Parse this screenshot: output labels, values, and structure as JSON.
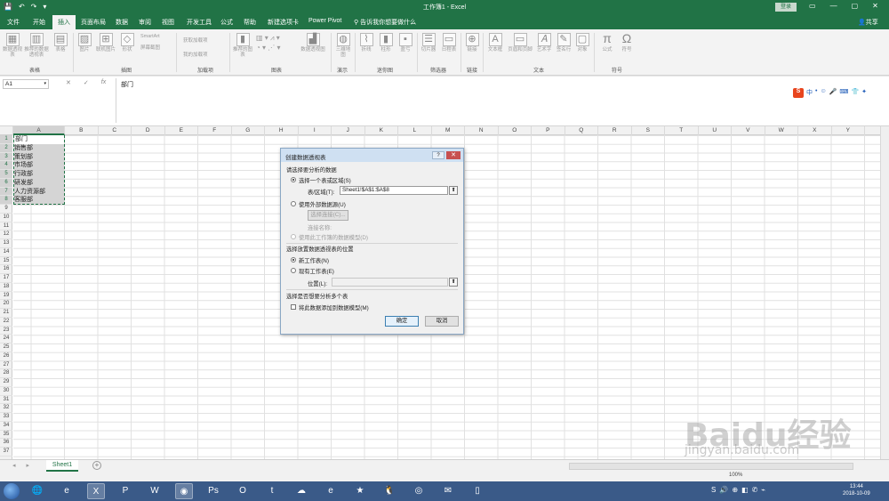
{
  "titlebar": {
    "title": "工作簿1 - Excel",
    "login": "登录",
    "qat": [
      "💾",
      "↶",
      "↷",
      "▾"
    ],
    "win": [
      "▭",
      "—",
      "▢",
      "✕"
    ]
  },
  "tabs": {
    "items": [
      "文件",
      "开始",
      "插入",
      "页面布局",
      "数据",
      "审阅",
      "视图",
      "开发工具",
      "公式",
      "帮助",
      "新建选项卡",
      "Power Pivot"
    ],
    "active": "插入",
    "tell_me": "告诉我你想要做什么",
    "share": "共享"
  },
  "ribbon": {
    "groups": [
      "表格",
      "插图",
      "加载项",
      "图表",
      "演示",
      "迷你图",
      "筛选器",
      "链接",
      "文本",
      "符号"
    ],
    "buttons": {
      "pivot": "数据透视表",
      "rec_pivot": "推荐的数据透视表",
      "table": "表格",
      "pictures": "图片",
      "online_pictures": "联机图片",
      "shapes": "形状",
      "smartart": "SmartArt",
      "screenshot": "屏幕截图",
      "get_addins": "获取加载项",
      "my_addins": "我的加载项",
      "rec_charts": "推荐的图表",
      "pivot_chart": "数据透视图",
      "map3d": "三维地图",
      "line": "折线",
      "column": "柱形",
      "winloss": "盈亏",
      "slicer": "切片器",
      "timeline": "日程表",
      "link": "链接",
      "textbox": "文本框",
      "header_footer": "页眉和页脚",
      "wordart": "艺术字",
      "signature": "签名行",
      "object": "对象",
      "equation": "公式",
      "symbol": "符号"
    }
  },
  "formula_bar": {
    "name_box": "A1",
    "value": "部门",
    "cancel": "✕",
    "enter": "✓",
    "fx": "fx"
  },
  "sogou": [
    "S",
    "中",
    "•",
    "☺",
    "🎤",
    "⌨",
    "👕",
    "✦"
  ],
  "grid": {
    "columns": [
      "A",
      "B",
      "C",
      "D",
      "E",
      "F",
      "G",
      "H",
      "I",
      "J",
      "K",
      "L",
      "M",
      "N",
      "O",
      "P",
      "Q",
      "R",
      "S",
      "T",
      "U",
      "V",
      "W",
      "X",
      "Y"
    ],
    "rows": [
      "1",
      "2",
      "3",
      "4",
      "5",
      "6",
      "7",
      "8",
      "9",
      "10",
      "11",
      "12",
      "13",
      "14",
      "15",
      "16",
      "17",
      "18",
      "19",
      "20",
      "21",
      "22",
      "23",
      "24",
      "25",
      "26",
      "27",
      "28",
      "29",
      "30",
      "31",
      "32",
      "33",
      "34",
      "35",
      "36",
      "37"
    ],
    "column_a": [
      "部门",
      "销售部",
      "策划部",
      "市场部",
      "行政部",
      "研发部",
      "人力资源部",
      "客服部"
    ]
  },
  "dialog": {
    "title": "创建数据透视表",
    "help": "?",
    "close": "✕",
    "section1": "请选择要分析的数据",
    "opt_select_range": "选择一个表或区域(S)",
    "range_label": "表/区域(T):",
    "range_value": "Sheet1!$A$1:$A$8",
    "opt_external": "使用外部数据源(U)",
    "choose_conn": "选择连接(C)...",
    "conn_name": "连接名称:",
    "opt_data_model": "使用此工作簿的数据模型(D)",
    "section2": "选择放置数据透视表的位置",
    "opt_new_sheet": "新工作表(N)",
    "opt_existing_sheet": "现有工作表(E)",
    "location_label": "位置(L):",
    "section3": "选择是否想要分析多个表",
    "add_to_model": "将此数据添加到数据模型(M)",
    "ok": "确定",
    "cancel": "取消"
  },
  "sheets": {
    "tabs": [
      "Sheet1"
    ],
    "add": "+",
    "nav": [
      "◂",
      "▸"
    ]
  },
  "status": {
    "zoom": "100%"
  },
  "taskbar": {
    "apps": [
      "🌐",
      "e",
      "X",
      "P",
      "W",
      "◉",
      "Ps",
      "O",
      "t",
      "☁",
      "e",
      "★",
      "🐧",
      "◎",
      "✉",
      "▯"
    ],
    "time": "13:44",
    "date": "2018-10-09",
    "tray": [
      "S",
      "🔊",
      "⊕",
      "◧",
      "✆",
      "⌁"
    ]
  },
  "watermark": {
    "brand": "Baidu经验",
    "url": "jingyan.baidu.com"
  }
}
